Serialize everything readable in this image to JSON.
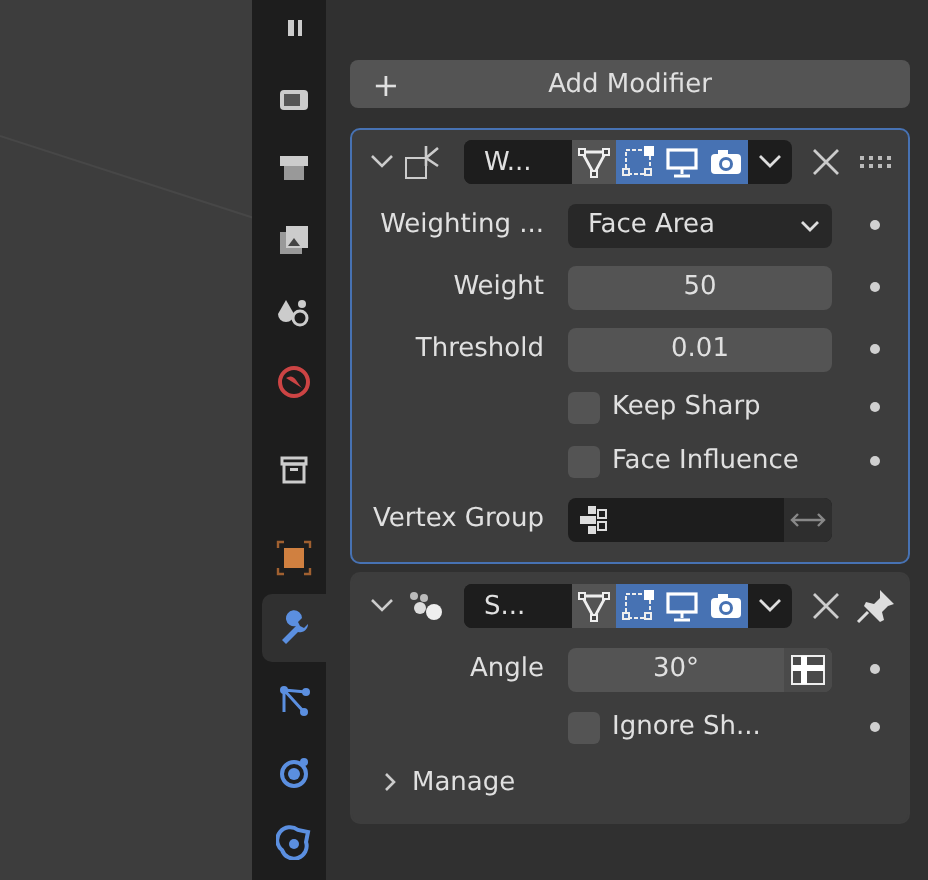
{
  "tabs": [
    {
      "selected": false
    },
    {
      "selected": false
    },
    {
      "selected": false
    },
    {
      "selected": false
    },
    {
      "selected": false
    },
    {
      "selected": false
    },
    {
      "selected": false
    },
    {
      "selected": false
    },
    {
      "selected": true
    },
    {
      "selected": false
    },
    {
      "selected": false
    },
    {
      "selected": false
    }
  ],
  "add_modifier": {
    "icon": "+",
    "label": "Add Modifier"
  },
  "modifiers": [
    {
      "name": "W...",
      "expanded": true,
      "active": true,
      "pinned": false,
      "toggles": [
        {
          "on": false
        },
        {
          "on": true
        },
        {
          "on": true
        },
        {
          "on": true
        }
      ],
      "properties": [
        {
          "kind": "dropdown",
          "label": "Weighting ...",
          "value": "Face Area"
        },
        {
          "kind": "number",
          "label": "Weight",
          "value": "50"
        },
        {
          "kind": "number",
          "label": "Threshold",
          "value": "0.01"
        },
        {
          "kind": "checkbox",
          "text": "Keep Sharp",
          "checked": false
        },
        {
          "kind": "checkbox",
          "text": "Face Influence",
          "checked": false
        },
        {
          "kind": "group",
          "label": "Vertex Group"
        }
      ]
    },
    {
      "name": "S...",
      "expanded": true,
      "active": false,
      "pinned": true,
      "toggles": [
        {
          "on": false
        },
        {
          "on": true
        },
        {
          "on": true
        },
        {
          "on": true
        }
      ],
      "properties": [
        {
          "kind": "angle",
          "label": "Angle",
          "value": "30°"
        },
        {
          "kind": "checkbox",
          "text": "Ignore Sh...",
          "checked": false
        }
      ],
      "subpanels": [
        {
          "label": "Manage",
          "expanded": false
        }
      ]
    }
  ]
}
